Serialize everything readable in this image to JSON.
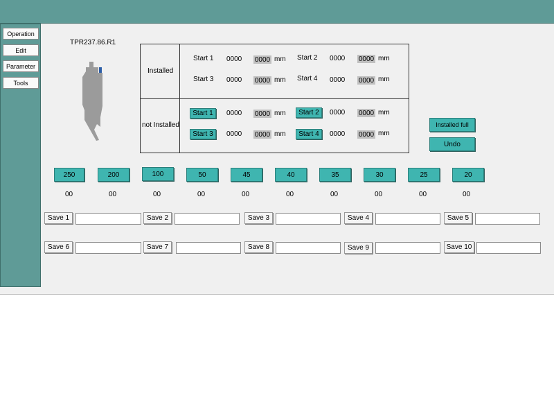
{
  "sidebar": {
    "items": [
      {
        "label": "Operation"
      },
      {
        "label": "Edit"
      },
      {
        "label": "Parameter"
      },
      {
        "label": "Tools"
      }
    ]
  },
  "tool": {
    "name": "TPR237.86.R1"
  },
  "installed_section": {
    "label": "Installed",
    "rows": [
      {
        "label": "Start 1",
        "value": "0000",
        "field": "0000",
        "unit": "mm"
      },
      {
        "label": "Start 2",
        "value": "0000",
        "field": "0000",
        "unit": "mm"
      },
      {
        "label": "Start 3",
        "value": "0000",
        "field": "0000",
        "unit": "mm"
      },
      {
        "label": "Start 4",
        "value": "0000",
        "field": "0000",
        "unit": "mm"
      }
    ]
  },
  "not_installed_section": {
    "label": "not Installed",
    "rows": [
      {
        "label": "Start 1",
        "value": "0000",
        "field": "0000",
        "unit": "mm"
      },
      {
        "label": "Start 2",
        "value": "0000",
        "field": "0000",
        "unit": "mm"
      },
      {
        "label": "Start 3",
        "value": "0000",
        "field": "0000",
        "unit": "mm"
      },
      {
        "label": "Start 4",
        "value": "0000",
        "field": "0000",
        "unit": "mm"
      }
    ]
  },
  "actions": {
    "installed_full": "Installed full",
    "undo": "Undo"
  },
  "segments": [
    {
      "label": "250",
      "count": "00"
    },
    {
      "label": "200",
      "count": "00"
    },
    {
      "label": "100",
      "count": "00"
    },
    {
      "label": "50",
      "count": "00"
    },
    {
      "label": "45",
      "count": "00"
    },
    {
      "label": "40",
      "count": "00"
    },
    {
      "label": "35",
      "count": "00"
    },
    {
      "label": "30",
      "count": "00"
    },
    {
      "label": "25",
      "count": "00"
    },
    {
      "label": "20",
      "count": "00"
    }
  ],
  "saves": [
    {
      "label": "Save 1",
      "value": ""
    },
    {
      "label": "Save 2",
      "value": ""
    },
    {
      "label": "Save 3",
      "value": ""
    },
    {
      "label": "Save 4",
      "value": ""
    },
    {
      "label": "Save 5",
      "value": ""
    },
    {
      "label": "Save 6",
      "value": ""
    },
    {
      "label": "Save 7",
      "value": ""
    },
    {
      "label": "Save 8",
      "value": ""
    },
    {
      "label": "Save 9",
      "value": ""
    },
    {
      "label": "Save 10",
      "value": ""
    }
  ],
  "colors": {
    "teal_frame": "#5f9b97",
    "teal_button": "#3fb5b0",
    "background": "#f0f0f0"
  }
}
